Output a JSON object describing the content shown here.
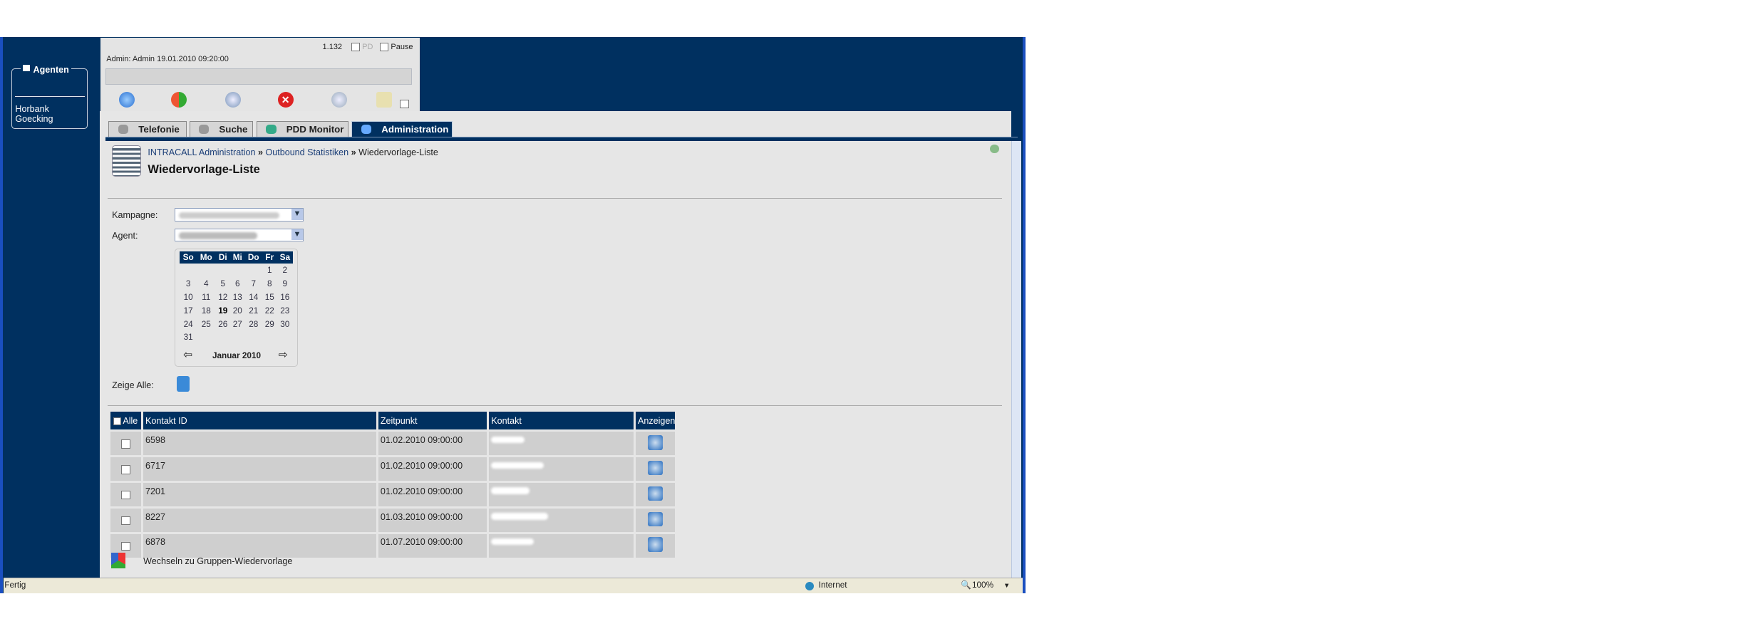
{
  "sidebar": {
    "title": "Agenten",
    "agents": [
      "Horbank",
      "Goecking"
    ]
  },
  "header": {
    "counter": "1.132",
    "pd_label": "PD",
    "pause_label": "Pause",
    "user_info": "Admin: Admin 19.01.2010 09:20:00",
    "tools": [
      "music-phone-icon",
      "refresh-icon",
      "stopwatch-icon",
      "cancel-icon",
      "chat-icon",
      "mail-lock-icon"
    ]
  },
  "tabs": [
    {
      "label": "Telefonie"
    },
    {
      "label": "Suche"
    },
    {
      "label": "PDD Monitor"
    },
    {
      "label": "Administration",
      "active": true
    }
  ],
  "breadcrumb": [
    "INTRACALL Administration",
    "Outbound Statistiken",
    "Wiedervorlage-Liste"
  ],
  "breadcrumb_sep": "»",
  "page_title": "Wiedervorlage-Liste",
  "filters": {
    "kampagne_label": "Kampagne:",
    "agent_label": "Agent:",
    "zeige_alle_label": "Zeige Alle:"
  },
  "calendar": {
    "days": [
      "So",
      "Mo",
      "Di",
      "Mi",
      "Do",
      "Fr",
      "Sa"
    ],
    "weeks": [
      [
        "",
        "",
        "",
        "",
        "",
        "1",
        "2"
      ],
      [
        "3",
        "4",
        "5",
        "6",
        "7",
        "8",
        "9"
      ],
      [
        "10",
        "11",
        "12",
        "13",
        "14",
        "15",
        "16"
      ],
      [
        "17",
        "18",
        "19",
        "20",
        "21",
        "22",
        "23"
      ],
      [
        "24",
        "25",
        "26",
        "27",
        "28",
        "29",
        "30"
      ],
      [
        "31",
        "",
        "",
        "",
        "",
        "",
        ""
      ]
    ],
    "selected": "19",
    "month": "Januar 2010"
  },
  "table": {
    "headers": {
      "all": "Alle",
      "id": "Kontakt ID",
      "time": "Zeitpunkt",
      "contact": "Kontakt",
      "show": "Anzeigen"
    },
    "rows": [
      {
        "id": "6598",
        "time": "01.02.2010 09:00:00"
      },
      {
        "id": "6717",
        "time": "01.02.2010 09:00:00"
      },
      {
        "id": "7201",
        "time": "01.02.2010 09:00:00"
      },
      {
        "id": "8227",
        "time": "01.03.2010 09:00:00"
      },
      {
        "id": "6878",
        "time": "01.07.2010 09:00:00"
      }
    ]
  },
  "switch_link": "Wechseln zu Gruppen-Wiedervorlage",
  "status": {
    "text": "Fertig",
    "zone": "Internet",
    "zoom": "100%"
  },
  "colors": {
    "navy": "#003060",
    "panel": "#e6e6e6",
    "row": "#cfcfcf"
  }
}
